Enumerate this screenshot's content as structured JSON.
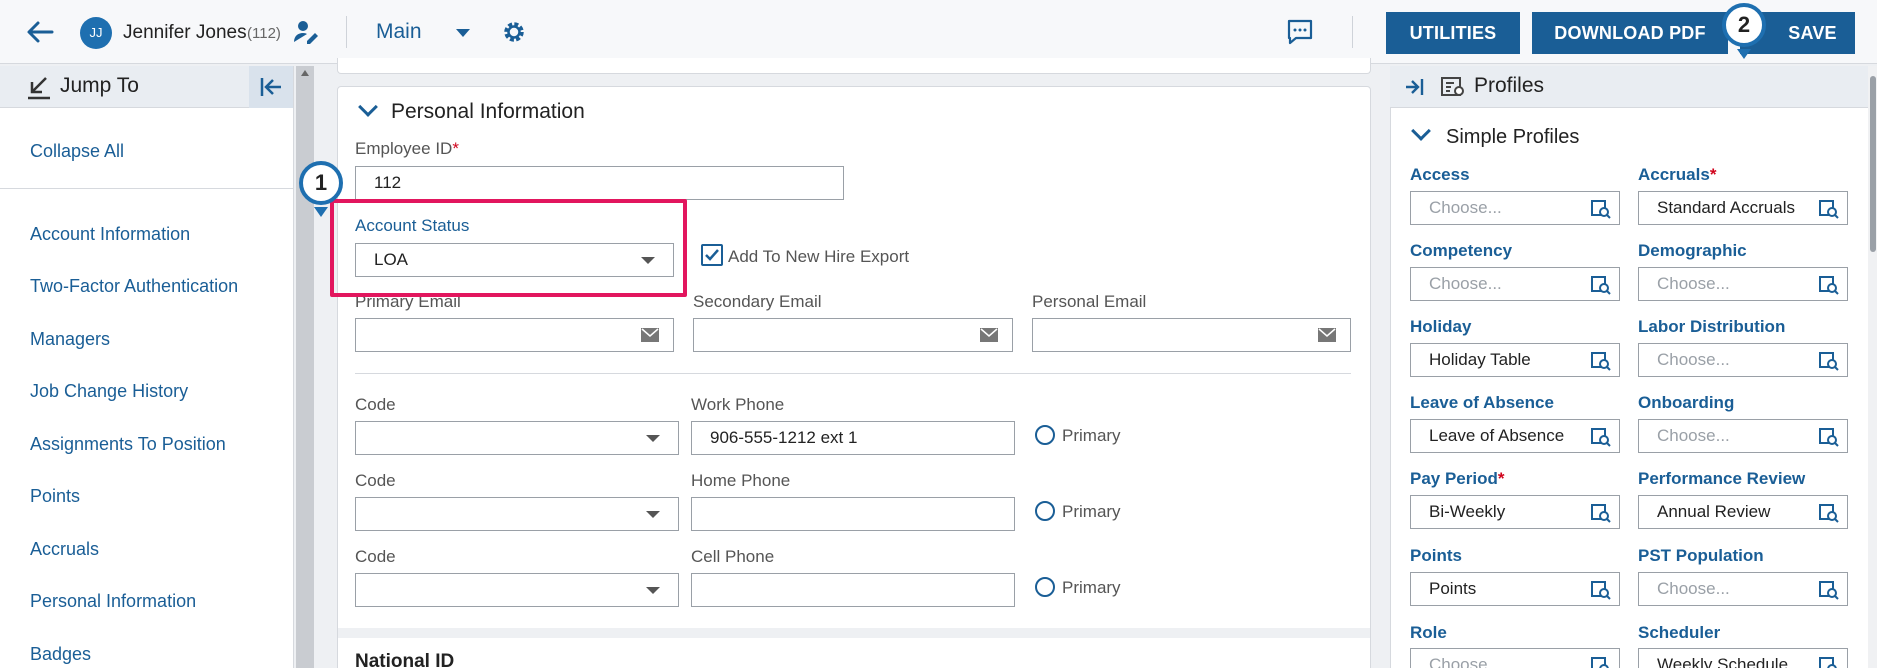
{
  "header": {
    "avatar_initials": "JJ",
    "user_name": "Jennifer Jones",
    "user_id": "(112)",
    "view_label": "Main",
    "buttons": {
      "utilities": "UTILITIES",
      "download_pdf": "DOWNLOAD PDF",
      "save": "SAVE"
    }
  },
  "jump_to": {
    "title": "Jump To",
    "collapse_all": "Collapse All",
    "items": [
      "Account Information",
      "Two-Factor Authentication",
      "Managers",
      "Job Change History",
      "Assignments To Position",
      "Points",
      "Accruals",
      "Personal Information",
      "Badges"
    ]
  },
  "personal_info": {
    "title": "Personal Information",
    "employee_id_label": "Employee ID",
    "employee_id_value": "112",
    "required_mark": "*",
    "account_status_label": "Account Status",
    "account_status_value": "LOA",
    "add_to_new_hire_export": "Add To New Hire Export",
    "primary_email_label": "Primary Email",
    "secondary_email_label": "Secondary Email",
    "personal_email_label": "Personal Email",
    "code_label": "Code",
    "work_phone_label": "Work Phone",
    "work_phone_value": "906-555-1212 ext 1",
    "home_phone_label": "Home Phone",
    "cell_phone_label": "Cell Phone",
    "primary_label": "Primary",
    "next_section": "National ID"
  },
  "profiles": {
    "title": "Profiles",
    "subtitle": "Simple Profiles",
    "placeholder": "Choose...",
    "required_mark": "*",
    "access": "Access",
    "accruals": "Accruals",
    "accruals_value": "Standard Accruals",
    "competency": "Competency",
    "demographic": "Demographic",
    "holiday": "Holiday",
    "holiday_value": "Holiday Table",
    "labor_distribution": "Labor Distribution",
    "leave_of_absence": "Leave of Absence",
    "leave_of_absence_value": "Leave of Absence",
    "onboarding": "Onboarding",
    "pay_period": "Pay Period",
    "pay_period_value": "Bi-Weekly",
    "performance_review": "Performance Review",
    "performance_review_value": "Annual Review",
    "points": "Points",
    "points_value": "Points",
    "pst_population": "PST Population",
    "role": "Role",
    "role_value": "Choose...",
    "scheduler": "Scheduler",
    "scheduler_value": "Weekly Schedule"
  },
  "callouts": {
    "one": "1",
    "two": "2"
  },
  "colors": {
    "accent": "#1a5e96",
    "highlight": "#e2165e",
    "required": "#d0021b"
  }
}
